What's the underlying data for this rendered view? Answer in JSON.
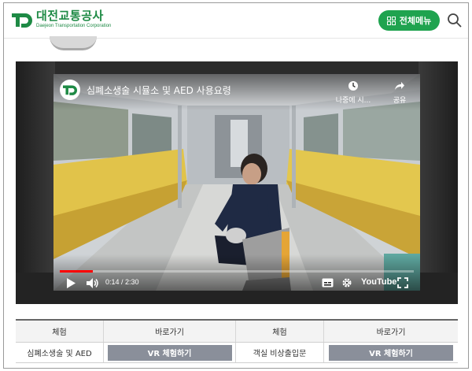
{
  "brand": {
    "name": "대전교통공사",
    "sub": "Daejeon Transportation Corporation",
    "color": "#1e8a45"
  },
  "header": {
    "menu_label": "전체메뉴",
    "menu_icon": "grid-icon",
    "search_icon": "search-icon"
  },
  "video": {
    "title": "심폐소생술 시뮬소 및 AED 사용요령",
    "watch_later_label": "나중에 시...",
    "share_label": "공유",
    "time": "0:14 / 2:30",
    "progress": 0.093,
    "platform": "YouTube"
  },
  "table": {
    "headers": [
      "체험",
      "바로가기",
      "체험",
      "바로가기"
    ],
    "rows": [
      [
        "심폐소생술 및 AED",
        "VR 체험하기",
        "객실 비상출입문",
        "VR 체험하기"
      ]
    ]
  },
  "colors": {
    "accent": "#1fa34f",
    "button_gray": "#8a8f9a",
    "progress_red": "#ff0000"
  }
}
